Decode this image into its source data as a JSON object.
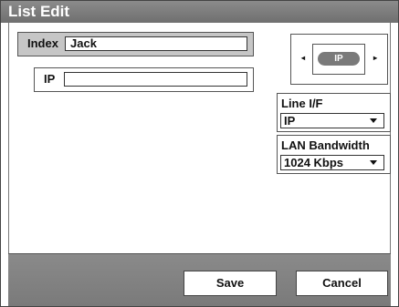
{
  "window": {
    "title": "List Edit"
  },
  "index": {
    "label": "Index",
    "value": "Jack"
  },
  "ip": {
    "label": "IP",
    "value": ""
  },
  "selector": {
    "left_arrow": "◂",
    "right_arrow": "▸",
    "current": "IP"
  },
  "line_if": {
    "title": "Line I/F",
    "value": "IP"
  },
  "lan_bandwidth": {
    "title": "LAN Bandwidth",
    "value": "1024 Kbps"
  },
  "buttons": {
    "save": "Save",
    "cancel": "Cancel"
  }
}
